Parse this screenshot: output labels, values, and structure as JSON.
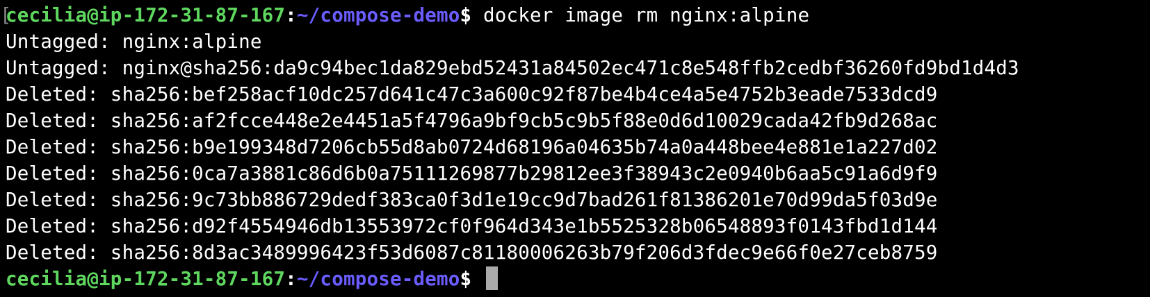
{
  "prompt": {
    "user_host": "cecilia@ip-172-31-87-167",
    "separator": ":",
    "path": "~/compose-demo",
    "symbol": "$ "
  },
  "command": "docker image rm nginx:alpine",
  "output": [
    "Untagged: nginx:alpine",
    "Untagged: nginx@sha256:da9c94bec1da829ebd52431a84502ec471c8e548ffb2cedbf36260fd9bd1d4d3",
    "Deleted: sha256:bef258acf10dc257d641c47c3a600c92f87be4b4ce4a5e4752b3eade7533dcd9",
    "Deleted: sha256:af2fcce448e2e4451a5f4796a9bf9cb5c9b5f88e0d6d10029cada42fb9d268ac",
    "Deleted: sha256:b9e199348d7206cb55d8ab0724d68196a04635b74a0a448bee4e881e1a227d02",
    "Deleted: sha256:0ca7a3881c86d6b0a75111269877b29812ee3f38943c2e0940b6aa5c91a6d9f9",
    "Deleted: sha256:9c73bb886729dedf383ca0f3d1e19cc9d7bad261f81386201e70d99da5f03d9e",
    "Deleted: sha256:d92f4554946db13553972cf0f964d343e1b5525328b06548893f0143fbd1d144",
    "Deleted: sha256:8d3ac3489996423f53d6087c81180006263b79f206d3fdec9e66f0e27ceb8759"
  ],
  "colors": {
    "background": "#000000",
    "text": "#ffffff",
    "user_host": "#5fd75f",
    "path": "#6a5cff",
    "cursor": "#aaaaaa"
  }
}
